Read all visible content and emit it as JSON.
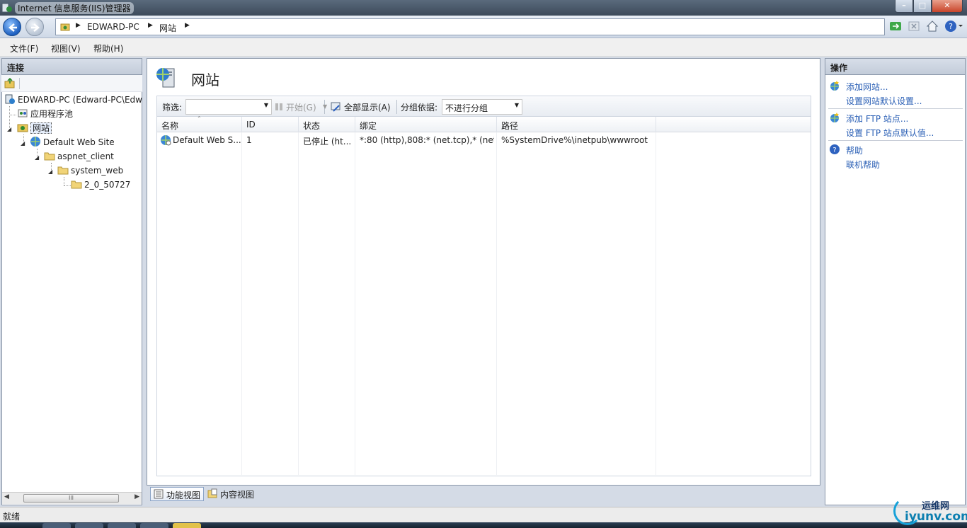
{
  "window": {
    "title": "Internet 信息服务(IIS)管理器"
  },
  "address": {
    "crumbs": [
      "EDWARD-PC",
      "网站"
    ]
  },
  "menu": {
    "file": "文件(F)",
    "view": "视图(V)",
    "help": "帮助(H)"
  },
  "connections": {
    "header": "连接",
    "tree": {
      "server": "EDWARD-PC (Edward-PC\\Edw",
      "app_pools": "应用程序池",
      "sites": "网站",
      "default_site": "Default Web Site",
      "aspnet_client": "aspnet_client",
      "system_web": "system_web",
      "version_folder": "2_0_50727"
    }
  },
  "main": {
    "title": "网站",
    "filter_label": "筛选:",
    "filter_value": "",
    "start_label": "开始(G)",
    "show_all_label": "全部显示(A)",
    "group_by_label": "分组依据:",
    "group_by_value": "不进行分组",
    "columns": [
      "名称",
      "ID",
      "状态",
      "绑定",
      "路径"
    ],
    "rows": [
      {
        "name": "Default Web S...",
        "id": "1",
        "status": "已停止 (ht...",
        "binding": "*:80 (http),808:* (net.tcp),* (net....",
        "path": "%SystemDrive%\\inetpub\\wwwroot"
      }
    ]
  },
  "view_tabs": {
    "features": "功能视图",
    "content": "内容视图"
  },
  "actions": {
    "header": "操作",
    "add_site": "添加网站...",
    "site_defaults": "设置网站默认设置...",
    "add_ftp": "添加 FTP 站点...",
    "ftp_defaults": "设置 FTP 站点默认值...",
    "help": "帮助",
    "online_help": "联机帮助"
  },
  "status": {
    "text": "就绪"
  },
  "watermark": {
    "line1": "运维网",
    "line2": "iyunv.com"
  },
  "colors": {
    "link": "#2a5fb5",
    "panel_border": "#8b97a9",
    "header_bg": "#c3ccd9"
  }
}
